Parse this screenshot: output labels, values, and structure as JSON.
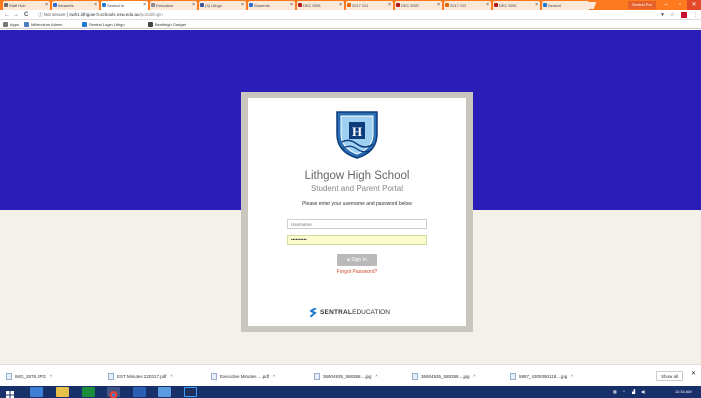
{
  "browser": {
    "tabs": [
      {
        "label": "Staff Hub",
        "color": "#6a6a6a",
        "active": false
      },
      {
        "label": "Intranets",
        "color": "#2d6fcf",
        "active": false
      },
      {
        "label": "Sentral fo",
        "color": "#1e7bd0",
        "active": true
      },
      {
        "label": "Executive",
        "color": "#8a8a8a",
        "active": false
      },
      {
        "label": "(3) Lithgo",
        "color": "#3b5998",
        "active": false
      },
      {
        "label": "Students",
        "color": "#2d6fcf",
        "active": false
      },
      {
        "label": "DEC EBS",
        "color": "#b01a1a",
        "active": false
      },
      {
        "label": "2017 GO",
        "color": "#e26a00",
        "active": false
      },
      {
        "label": "DEC EBS",
        "color": "#b01a1a",
        "active": false
      },
      {
        "label": "2017 GO",
        "color": "#e26a00",
        "active": false
      },
      {
        "label": "DEC EBS",
        "color": "#b01a1a",
        "active": false
      },
      {
        "label": "Sentral",
        "color": "#1e7bd0",
        "active": false
      }
    ],
    "profile_label": "Sentral Pro",
    "nav": {
      "back": "←",
      "forward": "→",
      "reload": "C"
    },
    "address": {
      "security": "Not secure",
      "host": "swh1.lithgow-h.schools.nsw.edu.au",
      "path": "/portal/login"
    },
    "bookmarks": [
      {
        "label": "Apps",
        "color": "#777777"
      },
      {
        "label": "Millennium Admin",
        "color": "#4a7ac0"
      },
      {
        "label": "Sentral Login Lithgo",
        "color": "#1e7bd0"
      },
      {
        "label": "Bentleigh Gadget",
        "color": "#444444"
      }
    ]
  },
  "login": {
    "school_name": "Lithgow High School",
    "portal_name": "Student and Parent Portal",
    "prompt": "Please enter your username and password below",
    "username_placeholder": "Username",
    "password_value": "••••••••••",
    "signin_label": "Sign In",
    "forgot_label": "Forgot Password?"
  },
  "branding": {
    "brand_bold": "SENTRAL",
    "brand_rest": "EDUCATION"
  },
  "downloads": {
    "items": [
      {
        "label": "IMG_2878.JPG"
      },
      {
        "label": "EST Minutes 220317.pdf"
      },
      {
        "label": "Executive Minutes ....pdf"
      },
      {
        "label": "36904935_588388....jpg"
      },
      {
        "label": "36904935_588388....jpg"
      },
      {
        "label": "5887_4309390118....jpg"
      }
    ],
    "show_all_label": "Show all"
  },
  "taskbar": {
    "clock": "11:34 AM"
  },
  "colors": {
    "hero": "#2a1db8",
    "tabstrip": "#fe7a1e",
    "taskbar": "#17306a"
  }
}
